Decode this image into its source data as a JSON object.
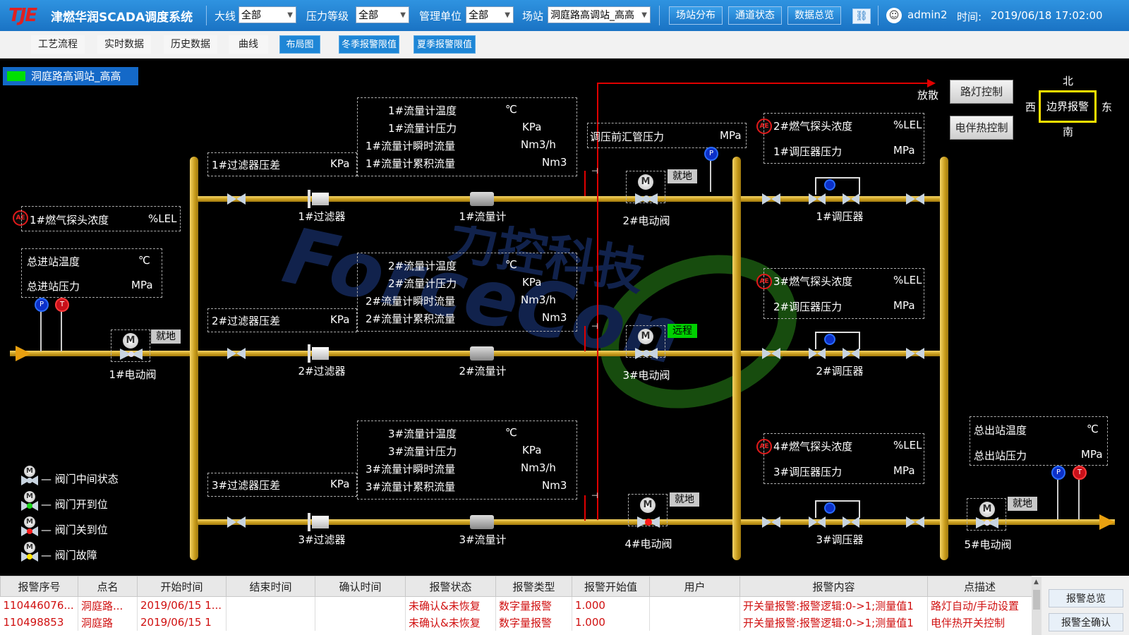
{
  "header": {
    "logo": "TJE",
    "title": "津燃华润SCADA调度系统",
    "filters": [
      {
        "label": "大线",
        "value": "全部"
      },
      {
        "label": "压力等级",
        "value": "全部"
      },
      {
        "label": "管理单位",
        "value": "全部"
      },
      {
        "label": "场站",
        "value": "洞庭路高调站_高高"
      }
    ],
    "buttons": [
      "场站分布",
      "通道状态",
      "数据总览"
    ],
    "user": "admin2",
    "time_label": "时间:",
    "time": "2019/06/18  17:02:00"
  },
  "nav": {
    "tabs": [
      "工艺流程",
      "实时数据",
      "历史数据",
      "曲线",
      "布局图",
      "冬季报警限值",
      "夏季报警限值"
    ]
  },
  "station": {
    "name": "洞庭路高调站_高高"
  },
  "controls": {
    "street_light": "路灯控制",
    "heat_trace": "电伴热控制",
    "vent": "放散"
  },
  "compass": {
    "north": "北",
    "south": "南",
    "west": "西",
    "east": "东",
    "boundary_alarm": "边界报警"
  },
  "inlet": {
    "gas_probe": "1#燃气探头浓度",
    "gas_unit": "%LEL",
    "temp": "总进站温度",
    "temp_unit": "℃",
    "pressure": "总进站压力",
    "pressure_unit": "MPa",
    "valve": "1#电动阀",
    "valve_mode": "就地"
  },
  "branches": [
    {
      "filter_dp": "1#过滤器压差",
      "dp_unit": "KPa",
      "filter": "1#过滤器",
      "meter": "1#流量计",
      "meter_rows": [
        [
          "1#流量计温度",
          "℃"
        ],
        [
          "1#流量计压力",
          "KPa"
        ],
        [
          "1#流量计瞬时流量",
          "Nm3/h"
        ],
        [
          "1#流量计累积流量",
          "Nm3"
        ]
      ],
      "valve": "2#电动阀",
      "valve_mode": "就地",
      "regulator": "1#调压器",
      "gas_probe": "2#燃气探头浓度",
      "reg_pressure": "1#调压器压力"
    },
    {
      "filter_dp": "2#过滤器压差",
      "dp_unit": "KPa",
      "filter": "2#过滤器",
      "meter": "2#流量计",
      "meter_rows": [
        [
          "2#流量计温度",
          "℃"
        ],
        [
          "2#流量计压力",
          "KPa"
        ],
        [
          "2#流量计瞬时流量",
          "Nm3/h"
        ],
        [
          "2#流量计累积流量",
          "Nm3"
        ]
      ],
      "valve": "3#电动阀",
      "valve_mode": "远程",
      "regulator": "2#调压器",
      "gas_probe": "3#燃气探头浓度",
      "reg_pressure": "2#调压器压力"
    },
    {
      "filter_dp": "3#过滤器压差",
      "dp_unit": "KPa",
      "filter": "3#过滤器",
      "meter": "3#流量计",
      "meter_rows": [
        [
          "3#流量计温度",
          "℃"
        ],
        [
          "3#流量计压力",
          "KPa"
        ],
        [
          "3#流量计瞬时流量",
          "Nm3/h"
        ],
        [
          "3#流量计累积流量",
          "Nm3"
        ]
      ],
      "valve": "4#电动阀",
      "valve_mode": "就地",
      "regulator": "3#调压器",
      "gas_probe": "4#燃气探头浓度",
      "reg_pressure": "3#调压器压力"
    }
  ],
  "pre_reg": {
    "label": "调压前汇管压力",
    "unit": "MPa"
  },
  "lel_unit": "%LEL",
  "mpa_unit": "MPa",
  "outlet": {
    "temp": "总出站温度",
    "temp_unit": "℃",
    "pressure": "总出站压力",
    "pressure_unit": "MPa",
    "valve": "5#电动阀",
    "valve_mode": "就地"
  },
  "legend": [
    "— 阀门中间状态",
    "— 阀门开到位",
    "— 阀门关到位",
    "— 阀门故障"
  ],
  "alarm_table": {
    "headers": [
      "报警序号",
      "点名",
      "开始时间",
      "结束时间",
      "确认时间",
      "报警状态",
      "报警类型",
      "报警开始值",
      "用户",
      "报警内容",
      "点描述"
    ],
    "rows": [
      [
        "110446076...",
        "洞庭路...",
        "2019/06/15 1...",
        "",
        "",
        "未确认&未恢复",
        "数字量报警",
        "1.000",
        "",
        "开关量报警:报警逻辑:0->1;测量值1",
        "路灯自动/手动设置"
      ],
      [
        "110498853",
        "洞庭路",
        "2019/06/15 1",
        "",
        "",
        "未确认&未恢复",
        "数字量报警",
        "1.000",
        "",
        "开关量报警:报警逻辑:0->1;测量值1",
        "电伴热开关控制"
      ]
    ],
    "side_buttons": [
      "报警总览",
      "报警全确认"
    ]
  },
  "watermark": {
    "cn": "力控科技",
    "en": "ForceCon"
  },
  "colors": {
    "pipe": "#d4a82a",
    "vent_line": "#e00000",
    "header_blue": "#1a73c4",
    "alarm_red": "#d01010"
  }
}
